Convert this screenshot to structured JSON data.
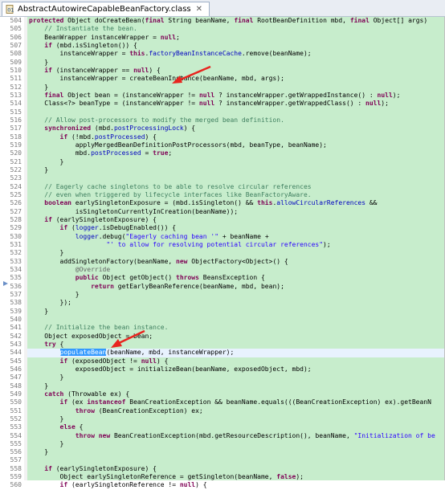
{
  "tab": {
    "title": "AbstractAutowireCapableBeanFactory.class",
    "close": "✕"
  },
  "lines": [
    {
      "n": "504",
      "t": "protected Object doCreateBean(final String beanName, final RootBeanDefinition mbd, final Object[] args)"
    },
    {
      "n": "505",
      "t": "    // Instantiate the bean."
    },
    {
      "n": "506",
      "t": "    BeanWrapper instanceWrapper = null;"
    },
    {
      "n": "507",
      "t": "    if (mbd.isSingleton()) {"
    },
    {
      "n": "508",
      "t": "        instanceWrapper = this.factoryBeanInstanceCache.remove(beanName);"
    },
    {
      "n": "509",
      "t": "    }"
    },
    {
      "n": "510",
      "t": "    if (instanceWrapper == null) {"
    },
    {
      "n": "511",
      "t": "        instanceWrapper = createBeanInstance(beanName, mbd, args);"
    },
    {
      "n": "512",
      "t": "    }"
    },
    {
      "n": "513",
      "t": "    final Object bean = (instanceWrapper != null ? instanceWrapper.getWrappedInstance() : null);"
    },
    {
      "n": "514",
      "t": "    Class<?> beanType = (instanceWrapper != null ? instanceWrapper.getWrappedClass() : null);"
    },
    {
      "n": "515",
      "t": ""
    },
    {
      "n": "516",
      "t": "    // Allow post-processors to modify the merged bean definition."
    },
    {
      "n": "517",
      "t": "    synchronized (mbd.postProcessingLock) {"
    },
    {
      "n": "518",
      "t": "        if (!mbd.postProcessed) {"
    },
    {
      "n": "519",
      "t": "            applyMergedBeanDefinitionPostProcessors(mbd, beanType, beanName);"
    },
    {
      "n": "520",
      "t": "            mbd.postProcessed = true;"
    },
    {
      "n": "521",
      "t": "        }"
    },
    {
      "n": "522",
      "t": "    }"
    },
    {
      "n": "523",
      "t": ""
    },
    {
      "n": "524",
      "t": "    // Eagerly cache singletons to be able to resolve circular references"
    },
    {
      "n": "525",
      "t": "    // even when triggered by lifecycle interfaces like BeanFactoryAware."
    },
    {
      "n": "526",
      "t": "    boolean earlySingletonExposure = (mbd.isSingleton() && this.allowCircularReferences &&"
    },
    {
      "n": "527",
      "t": "            isSingletonCurrentlyInCreation(beanName));"
    },
    {
      "n": "528",
      "t": "    if (earlySingletonExposure) {"
    },
    {
      "n": "529",
      "t": "        if (logger.isDebugEnabled()) {"
    },
    {
      "n": "530",
      "t": "            logger.debug(\"Eagerly caching bean '\" + beanName +"
    },
    {
      "n": "531",
      "t": "                    \"' to allow for resolving potential circular references\");"
    },
    {
      "n": "532",
      "t": "        }"
    },
    {
      "n": "533",
      "t": "        addSingletonFactory(beanName, new ObjectFactory<Object>() {"
    },
    {
      "n": "534",
      "t": "            @Override"
    },
    {
      "n": "535",
      "t": "            public Object getObject() throws BeansException {"
    },
    {
      "n": "536",
      "t": "                return getEarlyBeanReference(beanName, mbd, bean);"
    },
    {
      "n": "537",
      "t": "            }"
    },
    {
      "n": "538",
      "t": "        });"
    },
    {
      "n": "539",
      "t": "    }"
    },
    {
      "n": "540",
      "t": ""
    },
    {
      "n": "541",
      "t": "    // Initialize the bean instance."
    },
    {
      "n": "542",
      "t": "    Object exposedObject = bean;"
    },
    {
      "n": "543",
      "t": "    try {"
    },
    {
      "n": "544",
      "t": "        populateBean(beanName, mbd, instanceWrapper);"
    },
    {
      "n": "545",
      "t": "        if (exposedObject != null) {"
    },
    {
      "n": "546",
      "t": "            exposedObject = initializeBean(beanName, exposedObject, mbd);"
    },
    {
      "n": "547",
      "t": "        }"
    },
    {
      "n": "548",
      "t": "    }"
    },
    {
      "n": "549",
      "t": "    catch (Throwable ex) {"
    },
    {
      "n": "550",
      "t": "        if (ex instanceof BeanCreationException && beanName.equals(((BeanCreationException) ex).getBeanN"
    },
    {
      "n": "551",
      "t": "            throw (BeanCreationException) ex;"
    },
    {
      "n": "552",
      "t": "        }"
    },
    {
      "n": "553",
      "t": "        else {"
    },
    {
      "n": "554",
      "t": "            throw new BeanCreationException(mbd.getResourceDescription(), beanName, \"Initialization of be"
    },
    {
      "n": "555",
      "t": "        }"
    },
    {
      "n": "556",
      "t": "    }"
    },
    {
      "n": "557",
      "t": ""
    },
    {
      "n": "558",
      "t": "    if (earlySingletonExposure) {"
    },
    {
      "n": "559",
      "t": "        Object earlySingletonReference = getSingleton(beanName, false);"
    },
    {
      "n": "560",
      "t": "        if (earlySingletonReference != null) {"
    }
  ],
  "current_line": "544",
  "selection": {
    "line": "544",
    "text": "populateBean"
  },
  "colors": {
    "background": "#c7edcc",
    "keyword": "#7f0055",
    "comment": "#3f7f5f",
    "string": "#2a00ff",
    "field": "#0000c0",
    "annotation": "#646464",
    "arrow": "#e8251f"
  }
}
